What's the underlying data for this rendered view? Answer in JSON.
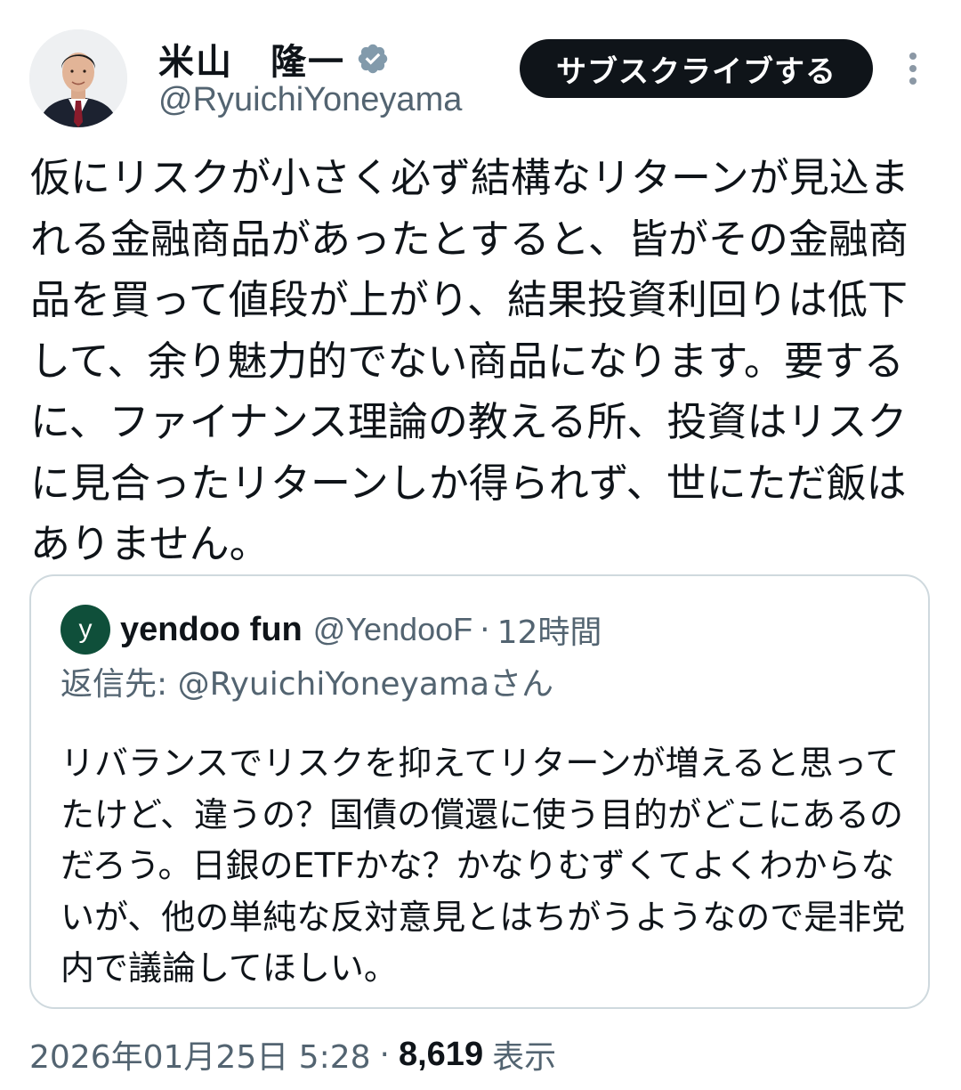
{
  "header": {
    "author_name": "米山　隆一",
    "author_handle": "@RyuichiYoneyama",
    "subscribe_label": "サブスクライブする",
    "verified_color": "#536471",
    "more_icon": "more-vertical-icon"
  },
  "tweet": {
    "text": "仮にリスクが小さく必ず結構なリターンが見込まれる金融商品があったとすると、皆がその金融商品を買って値段が上がり、結果投資利回りは低下して、余り魅力的でない商品になります。要するに、ファイナンス理論の教える所、投資はリスクに見合ったリターンしか得られず、世にただ飯はありません。"
  },
  "quote": {
    "avatar_letter": "y",
    "avatar_color": "#0f4f3a",
    "name": "yendoo fun",
    "handle": "@YendooF",
    "separator": "·",
    "time": "12時間",
    "reply_to": "返信先: @RyuichiYoneyamaさん",
    "text": "リバランスでリスクを抑えてリターンが増えると思ってたけど、違うの？国債の償還に使う目的がどこにあるのだろう。日銀のETFかな？かなりむずくてよくわからないが、他の単純な反対意見とはちがうようなので是非党内で議論してほしい。"
  },
  "meta": {
    "timestamp": "2026年01月25日 5:28",
    "separator": "·",
    "views": "8,619",
    "views_label": "表示"
  }
}
